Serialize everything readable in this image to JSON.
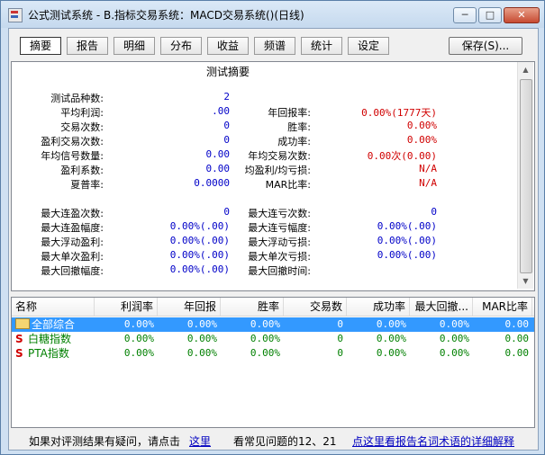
{
  "window": {
    "title": "公式测试系统 - B.指标交易系统：MACD交易系统()(日线)"
  },
  "toolbar": {
    "tabs": [
      "摘要",
      "报告",
      "明细",
      "分布",
      "收益",
      "频谱",
      "统计",
      "设定"
    ],
    "active_tab": "摘要",
    "save_label": "保存(S)..."
  },
  "summary": {
    "title": "测试摘要",
    "left": [
      {
        "label": "测试品种数:",
        "value": "2"
      },
      {
        "label": "平均利润:",
        "value": ".00"
      },
      {
        "label": "交易次数:",
        "value": "0"
      },
      {
        "label": "盈利交易次数:",
        "value": "0"
      },
      {
        "label": "年均信号数量:",
        "value": "0.00"
      },
      {
        "label": "盈利系数:",
        "value": "0.00"
      },
      {
        "label": "夏普率:",
        "value": "0.0000"
      }
    ],
    "right": [
      {
        "label": "年回报率:",
        "value": "0.00%(1777天)"
      },
      {
        "label": "胜率:",
        "value": "0.00%"
      },
      {
        "label": "成功率:",
        "value": "0.00%"
      },
      {
        "label": "年均交易次数:",
        "value": "0.00次(0.00)"
      },
      {
        "label": "均盈利/均亏损:",
        "value": "N/A"
      },
      {
        "label": "MAR比率:",
        "value": "N/A"
      }
    ],
    "left2": [
      {
        "label": "最大连盈次数:",
        "value": "0"
      },
      {
        "label": "最大连盈幅度:",
        "value": "0.00%(.00)"
      },
      {
        "label": "最大浮动盈利:",
        "value": "0.00%(.00)"
      },
      {
        "label": "最大单次盈利:",
        "value": "0.00%(.00)"
      },
      {
        "label": "最大回撤幅度:",
        "value": "0.00%(.00)"
      }
    ],
    "right2": [
      {
        "label": "最大连亏次数:",
        "value": "0"
      },
      {
        "label": "最大连亏幅度:",
        "value": "0.00%(.00)"
      },
      {
        "label": "最大浮动亏损:",
        "value": "0.00%(.00)"
      },
      {
        "label": "最大单次亏损:",
        "value": "0.00%(.00)"
      },
      {
        "label": "最大回撤时间:",
        "value": ""
      }
    ]
  },
  "table": {
    "columns": [
      "名称",
      "利润率",
      "年回报",
      "胜率",
      "交易数",
      "成功率",
      "最大回撤...",
      "MAR比率"
    ],
    "rows": [
      {
        "icon": "folder-icon",
        "name": "全部综合",
        "values": [
          "0.00%",
          "0.00%",
          "0.00%",
          "0",
          "0.00%",
          "0.00%",
          "0.00"
        ],
        "selected": true
      },
      {
        "icon": "s-icon",
        "name": "白糖指数",
        "values": [
          "0.00%",
          "0.00%",
          "0.00%",
          "0",
          "0.00%",
          "0.00%",
          "0.00"
        ],
        "selected": false
      },
      {
        "icon": "s-icon",
        "name": "PTA指数",
        "values": [
          "0.00%",
          "0.00%",
          "0.00%",
          "0",
          "0.00%",
          "0.00%",
          "0.00"
        ],
        "selected": false
      }
    ]
  },
  "footer": {
    "prefix": "如果对评测结果有疑问，请点击",
    "link1": "这里",
    "middle": "看常见问题的12、21",
    "link2": "点这里看报告名词术语的详细解释"
  },
  "colors": {
    "value_blue": "#0000c8",
    "value_red": "#d00000",
    "green": "#008000",
    "selection": "#3399ff"
  }
}
